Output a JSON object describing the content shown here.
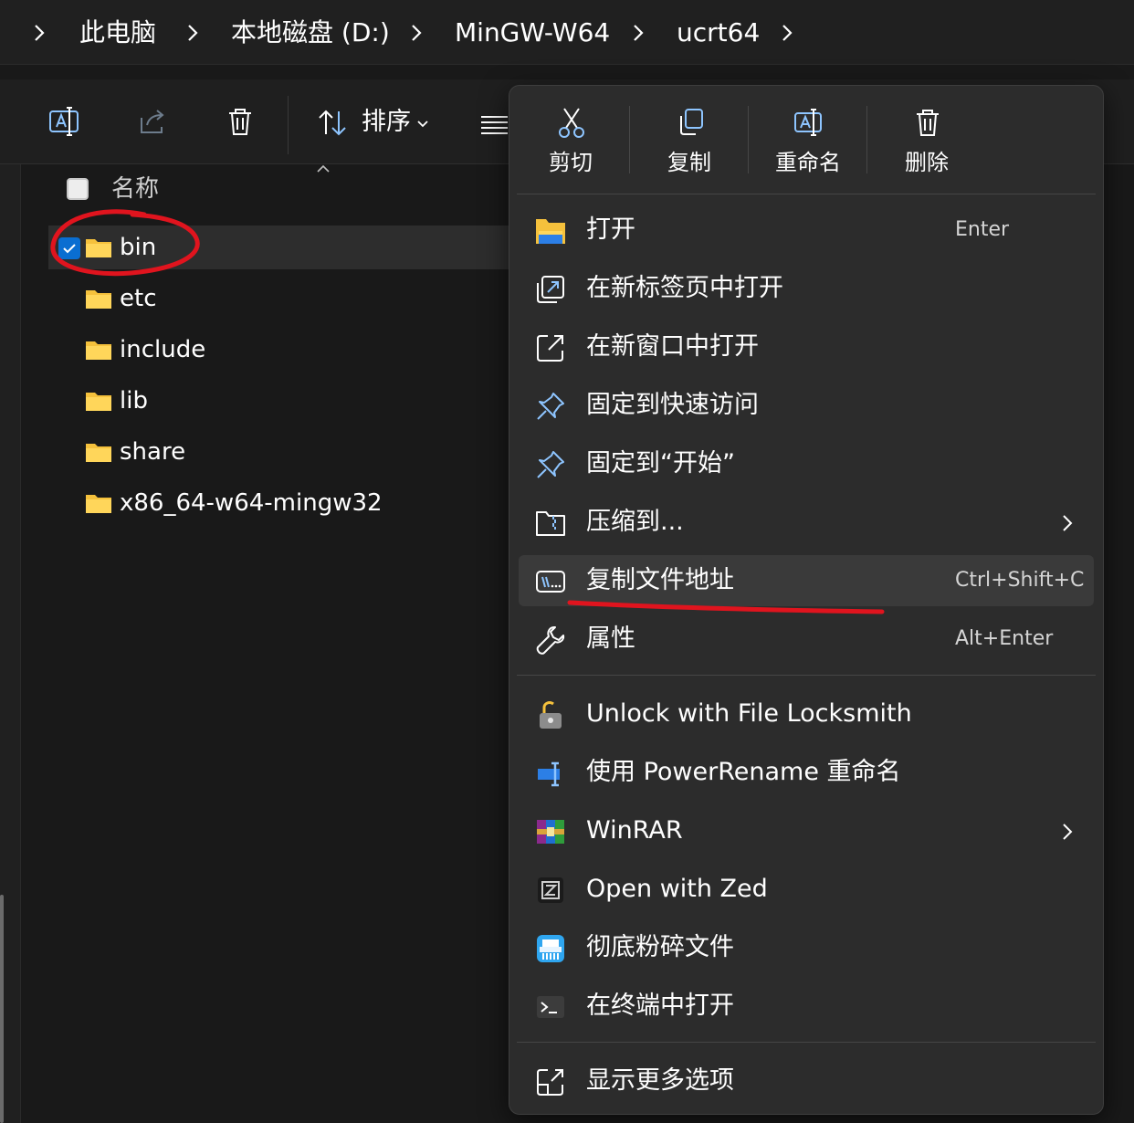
{
  "breadcrumb": {
    "items": [
      {
        "label": "此电脑"
      },
      {
        "label": "本地磁盘 (D:)"
      },
      {
        "label": "MinGW-W64"
      },
      {
        "label": "ucrt64"
      }
    ]
  },
  "toolbar": {
    "sort_label": "排序"
  },
  "file_list": {
    "header_name": "名称",
    "rows": [
      {
        "label": "bin",
        "selected": true
      },
      {
        "label": "etc"
      },
      {
        "label": "include"
      },
      {
        "label": "lib"
      },
      {
        "label": "share"
      },
      {
        "label": "x86_64-w64-mingw32"
      }
    ]
  },
  "context_menu": {
    "quick_actions": [
      {
        "label": "剪切"
      },
      {
        "label": "复制"
      },
      {
        "label": "重命名"
      },
      {
        "label": "删除"
      }
    ],
    "items": [
      {
        "label": "打开",
        "shortcut": "Enter"
      },
      {
        "label": "在新标签页中打开"
      },
      {
        "label": "在新窗口中打开"
      },
      {
        "label": "固定到快速访问"
      },
      {
        "label": "固定到“开始”"
      },
      {
        "label": "压缩到..."
      },
      {
        "label": "复制文件地址",
        "shortcut": "Ctrl+Shift+C"
      },
      {
        "label": "属性",
        "shortcut": "Alt+Enter"
      }
    ],
    "extension_items": [
      {
        "label": "Unlock with File Locksmith"
      },
      {
        "label": "使用 PowerRename 重命名"
      },
      {
        "label": "WinRAR"
      },
      {
        "label": "Open with Zed"
      },
      {
        "label": "彻底粉碎文件"
      },
      {
        "label": "在终端中打开"
      }
    ],
    "more_options": {
      "label": "显示更多选项"
    }
  },
  "colors": {
    "accent": "#0a6ed1",
    "annotation": "#e0141e",
    "folder": "#f5c13c"
  }
}
